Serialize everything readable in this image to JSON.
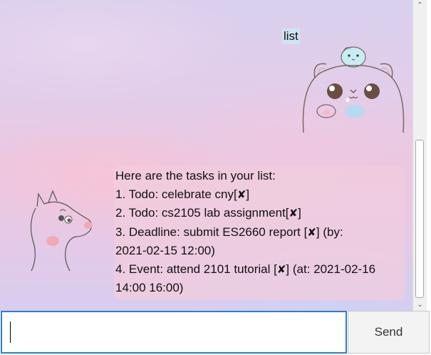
{
  "chat": {
    "user_message": "list",
    "bot_lines": [
      {
        "text": "Here are the tasks in your list:",
        "mark": "",
        "tail": ""
      },
      {
        "text": "1. Todo:  celebrate cny[",
        "mark": "✘",
        "tail": "]"
      },
      {
        "text": "2. Todo:  cs2105 lab assignment[",
        "mark": "✘",
        "tail": "]"
      },
      {
        "text": "3. Deadline:  submit ES2660 report [",
        "mark": "✘",
        "tail": "]  (by:"
      },
      {
        "text": "2021-02-15 12:00)",
        "mark": "",
        "tail": ""
      },
      {
        "text": "4. Event:  attend 2101 tutorial [",
        "mark": "✘",
        "tail": "] (at: 2021-02-16"
      },
      {
        "text": "14:00 16:00)",
        "mark": "",
        "tail": ""
      }
    ],
    "user_avatar_icon": "bear-with-bird-avatar-icon",
    "bot_avatar_icon": "moomin-avatar-icon",
    "bubble_color": "#f0cdde"
  },
  "scrollbar": {
    "up_arrow": "⌃",
    "down_arrow": "⌄"
  },
  "input": {
    "value": "",
    "placeholder": "",
    "focus_color": "#2d7fd1"
  },
  "send": {
    "label": "Send"
  }
}
